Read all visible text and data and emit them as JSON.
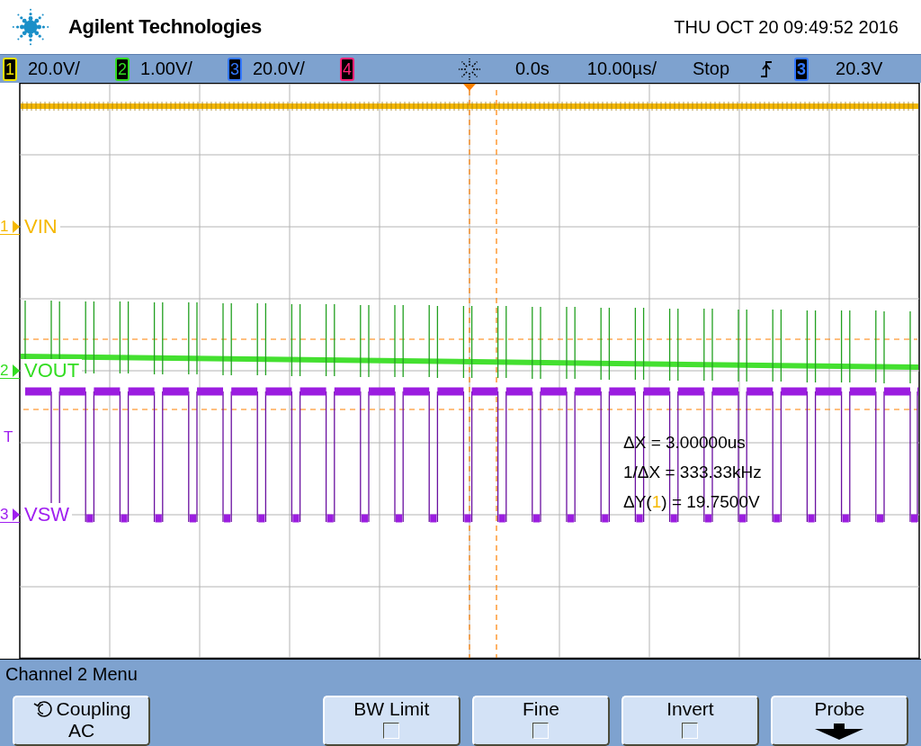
{
  "header": {
    "brand": "Agilent Technologies",
    "datetime": "THU OCT 20 09:49:52 2016"
  },
  "status_bar": {
    "channels": [
      {
        "number": "1",
        "scale": "20.0V/",
        "color": "#f0e000"
      },
      {
        "number": "2",
        "scale": "1.00V/",
        "color": "#33dd22"
      },
      {
        "number": "3",
        "scale": "20.0V/",
        "color": "#3377ff"
      },
      {
        "number": "4",
        "color": "#ff2277"
      }
    ],
    "time_position": "0.0s",
    "time_scale": "10.00µs/",
    "run_state": "Stop",
    "trigger": {
      "source": "3",
      "level": "20.3V",
      "color": "#3377ff"
    }
  },
  "display": {
    "markers": [
      {
        "number": "1",
        "label": "VIN",
        "color": "#f5b800"
      },
      {
        "number": "2",
        "label": "VOUT",
        "color": "#33dd22"
      },
      {
        "number": "3",
        "label": "VSW",
        "color": "#a020f0"
      }
    ],
    "trigger_marker": "T",
    "measurements": [
      {
        "text": "ΔX = 3.00000us"
      },
      {
        "text": "1/ΔX = 333.33kHz"
      },
      {
        "before": "ΔY(",
        "source": "1",
        "after": ") = 19.7500V"
      }
    ]
  },
  "menu": {
    "title": "Channel 2 Menu",
    "softkeys": [
      {
        "kind": "cycle",
        "label": "Coupling",
        "value": "AC"
      },
      {
        "kind": "toggle",
        "label": "BW Limit",
        "checked": false
      },
      {
        "kind": "toggle",
        "label": "Fine",
        "checked": false
      },
      {
        "kind": "toggle",
        "label": "Invert",
        "checked": false
      },
      {
        "kind": "submenu",
        "label": "Probe"
      }
    ]
  }
}
